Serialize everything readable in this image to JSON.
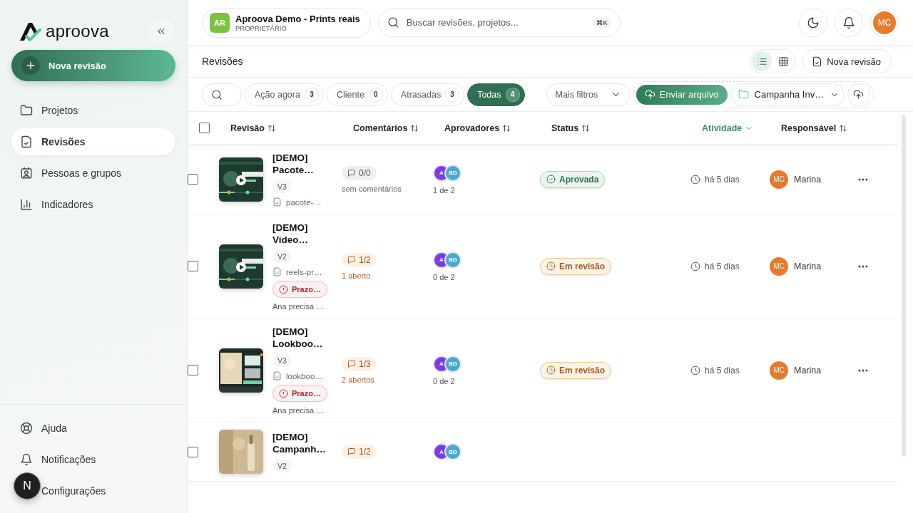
{
  "app": {
    "logo": "aproova"
  },
  "sidebar": {
    "new_button": "Nova revisão",
    "items": [
      {
        "label": "Projetos",
        "selected": false
      },
      {
        "label": "Revisões",
        "selected": true
      },
      {
        "label": "Pessoas e grupos",
        "selected": false
      },
      {
        "label": "Indicadores",
        "selected": false
      }
    ],
    "footer_items": [
      {
        "label": "Ajuda"
      },
      {
        "label": "Notificações"
      },
      {
        "label": "Configurações"
      }
    ]
  },
  "floating_badge": "N",
  "topbar": {
    "workspace": {
      "initials": "AR",
      "name": "Aproova Demo - Prints reais",
      "role": "PROPRIETÁRIO"
    },
    "search": {
      "placeholder": "Buscar revisões, projetos...",
      "shortcut": "⌘K"
    },
    "user_initials": "MC"
  },
  "page": {
    "title": "Revisões",
    "views": [
      {
        "kind": "list",
        "selected": true
      },
      {
        "kind": "grid",
        "selected": false
      }
    ],
    "new_button": "Nova revisão"
  },
  "filters": {
    "chips": [
      {
        "label": "Ação agora",
        "count": "3",
        "selected": false
      },
      {
        "label": "Cliente",
        "count": "0",
        "selected": false
      },
      {
        "label": "Atrasadas",
        "count": "3",
        "selected": false
      },
      {
        "label": "Todas",
        "count": "4",
        "selected": true
      }
    ],
    "more": "Mais filtros",
    "upload_button": "Enviar arquivo",
    "project": "Campanha Inv…"
  },
  "table": {
    "select_all_checked": false,
    "columns": [
      {
        "label": "Revisão",
        "sorted": false
      },
      {
        "label": "Comentários",
        "sorted": false
      },
      {
        "label": "Aprovadores",
        "sorted": false
      },
      {
        "label": "Status",
        "sorted": false
      },
      {
        "label": "Atividade",
        "sorted": true
      },
      {
        "label": "Responsável",
        "sorted": false
      }
    ],
    "rows": [
      {
        "checked": false,
        "title": "[DEMO] Pacote…",
        "version": "V3",
        "file": "pacote-…",
        "comments": {
          "kind": "none",
          "count": "0/0",
          "summary": "sem comentários"
        },
        "approvers": [
          {
            "initials": "A",
            "color": "#7c3aed"
          },
          {
            "initials": "BD",
            "color": "#4aaacb"
          }
        ],
        "approvals": "1 de 2",
        "status": {
          "kind": "approved",
          "label": "Aprovada"
        },
        "activity": "há 5 dias",
        "owner": {
          "initials": "MC",
          "name": "Marina"
        }
      },
      {
        "checked": false,
        "title": "[DEMO] Video…",
        "version": "V2",
        "file": "reels-pr…",
        "deadline": "Prazo…",
        "note": "Ana precisa …",
        "comments": {
          "kind": "open",
          "count": "1/2",
          "summary": "1 aberto"
        },
        "approvers": [
          {
            "initials": "A",
            "color": "#7c3aed"
          },
          {
            "initials": "BD",
            "color": "#4aaacb"
          }
        ],
        "approvals": "0 de 2",
        "status": {
          "kind": "review",
          "label": "Em revisão"
        },
        "activity": "há 5 dias",
        "owner": {
          "initials": "MC",
          "name": "Marina"
        }
      },
      {
        "checked": false,
        "title": "[DEMO] Lookboo…",
        "version": "V3",
        "file": "lookboo…",
        "deadline": "Prazo…",
        "note": "Ana precisa …",
        "comments": {
          "kind": "open",
          "count": "1/3",
          "summary": "2 abertos"
        },
        "approvers": [
          {
            "initials": "A",
            "color": "#7c3aed"
          },
          {
            "initials": "BD",
            "color": "#4aaacb"
          }
        ],
        "approvals": "0 de 2",
        "status": {
          "kind": "review",
          "label": "Em revisão"
        },
        "activity": "há 5 dias",
        "owner": {
          "initials": "MC",
          "name": "Marina"
        }
      },
      {
        "checked": false,
        "title": "[DEMO] Campanh…",
        "version": "V2",
        "comments": {
          "kind": "open",
          "count": "1/2"
        },
        "approvers": [
          {
            "initials": "A",
            "color": "#7c3aed"
          },
          {
            "initials": "BD",
            "color": "#4aaacb"
          }
        ]
      }
    ]
  }
}
